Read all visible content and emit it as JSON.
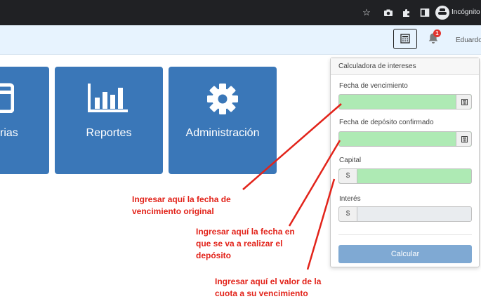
{
  "browser": {
    "mode_label": "Incógnito",
    "icons": [
      "star-icon",
      "camera-icon",
      "puzzle-icon",
      "sidebar-icon",
      "incognito-icon"
    ]
  },
  "navbar": {
    "calculator_icon": "calculator-icon",
    "notification_count": "1",
    "user_name": "Eduardo"
  },
  "tiles": [
    {
      "label": "rias",
      "icon": "calendar-icon"
    },
    {
      "label": "Reportes",
      "icon": "bar-chart-icon"
    },
    {
      "label": "Administración",
      "icon": "gear-icon"
    }
  ],
  "calculator": {
    "title": "Calculadora de intereses",
    "fields": {
      "due_date": {
        "label": "Fecha de vencimiento",
        "value": ""
      },
      "deposit_date": {
        "label": "Fecha de depósito confirmado",
        "value": ""
      },
      "capital": {
        "label": "Capital",
        "prefix": "$",
        "value": ""
      },
      "interest": {
        "label": "Interés",
        "prefix": "$",
        "value": ""
      }
    },
    "submit_label": "Calcular"
  },
  "annotations": {
    "due_date_line1": "Ingresar aquí la fecha de",
    "due_date_line2": "vencimiento original",
    "deposit_line1": "Ingresar aquí la fecha en",
    "deposit_line2": "que se va a realizar el",
    "deposit_line3": "depósito",
    "capital_line1": "Ingresar aquí el valor de la",
    "capital_line2": "cuota a su vencimiento"
  },
  "colors": {
    "tile_blue": "#3a77b8",
    "input_green": "#aeeab4",
    "annotation_red": "#e2231a",
    "button_blue": "#7fa9d3"
  }
}
